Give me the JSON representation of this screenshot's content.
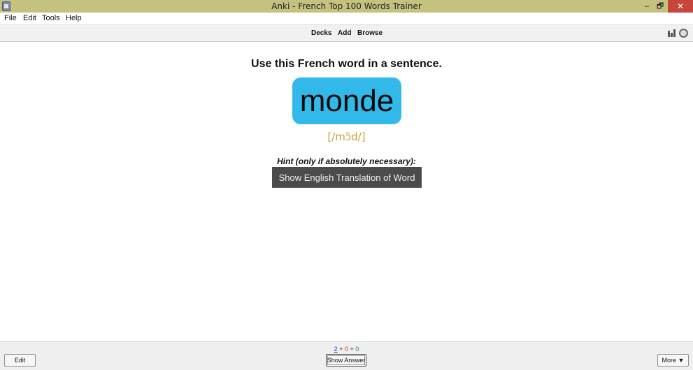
{
  "window": {
    "title": "Anki - French Top 100 Words Trainer",
    "controls": {
      "minimize": "–",
      "maximize": "🗗",
      "close": "✕"
    }
  },
  "menubar": {
    "items": [
      "File",
      "Edit",
      "Tools",
      "Help"
    ]
  },
  "toolbar": {
    "decks": "Decks",
    "add": "Add",
    "browse": "Browse",
    "icons": [
      "stats-icon",
      "sync-icon"
    ]
  },
  "card": {
    "prompt": "Use this French word in a sentence.",
    "word": "monde",
    "ipa": "[/mɔ̃d/]",
    "hint_label": "Hint (only if absolutely necessary):",
    "hint_button": "Show English Translation of Word",
    "colors": {
      "word_box": "#33b8ea",
      "ipa": "#c8a03a",
      "hint_button": "#4b4b4b"
    }
  },
  "bottombar": {
    "counts": {
      "new": "2",
      "learning": "0",
      "review": "0",
      "separator": "+"
    },
    "edit_button": "Edit",
    "show_answer_button": "Show Answer",
    "more_button": "More ▼"
  }
}
